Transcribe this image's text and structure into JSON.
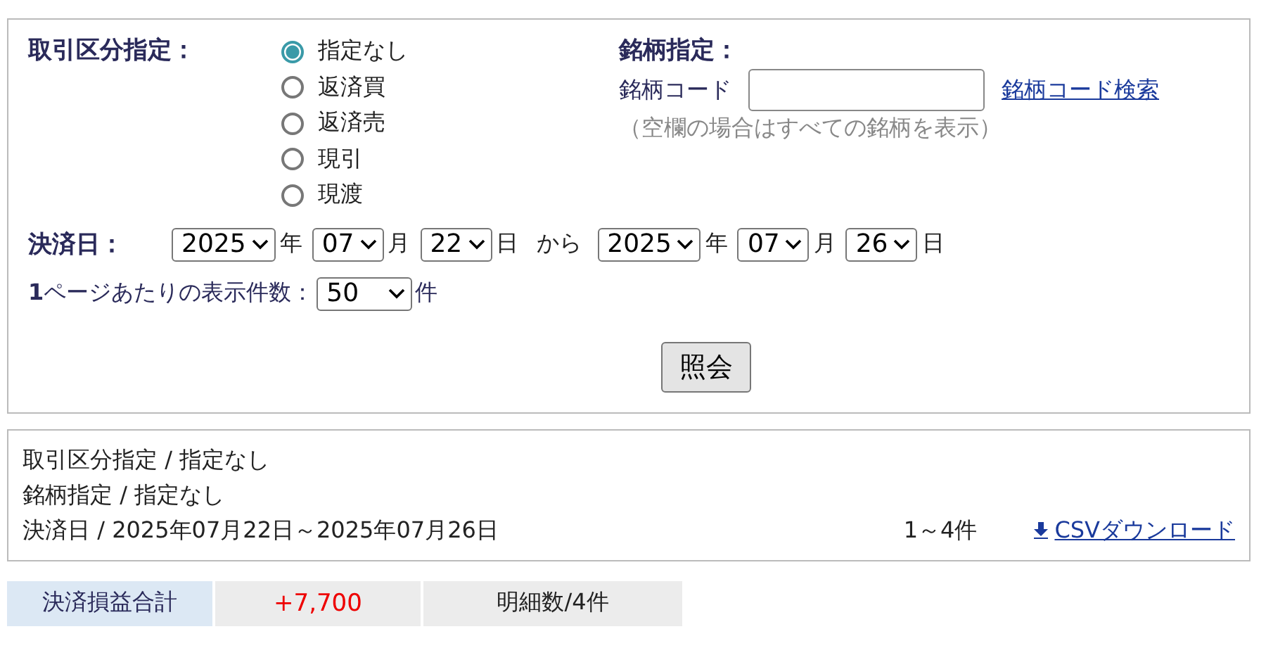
{
  "filter": {
    "trade_type": {
      "label": "取引区分指定：",
      "options": [
        {
          "label": "指定なし",
          "selected": true
        },
        {
          "label": "返済買",
          "selected": false
        },
        {
          "label": "返済売",
          "selected": false
        },
        {
          "label": "現引",
          "selected": false
        },
        {
          "label": "現渡",
          "selected": false
        }
      ]
    },
    "stock": {
      "label": "銘柄指定：",
      "code_label": "銘柄コード",
      "link": "銘柄コード検索",
      "hint": "（空欄の場合はすべての銘柄を表示）"
    },
    "date": {
      "label": "決済日：",
      "from": [
        {
          "value": "2025",
          "unit": "年"
        },
        {
          "value": "07",
          "unit": "月"
        },
        {
          "value": "22",
          "unit": "日"
        }
      ],
      "separator": "から",
      "to": [
        {
          "value": "2025",
          "unit": "年"
        },
        {
          "value": "07",
          "unit": "月"
        },
        {
          "value": "26",
          "unit": "日"
        }
      ]
    },
    "per_page": {
      "label": "**1**ページあたりの表示件数：",
      "value": "50",
      "unit": "件"
    },
    "submit": "照会"
  },
  "summary": {
    "lines": [
      "取引区分指定 / 指定なし",
      "銘柄指定 /  指定なし",
      "決済日 / 2025年07月22日～2025年07月26日"
    ],
    "count": "1～4件",
    "csv_link": "CSVダウンロード"
  },
  "totals": [
    {
      "kind": "label",
      "text": "決済損益合計"
    },
    {
      "kind": "value",
      "text": "+7,700"
    },
    {
      "kind": "count",
      "text": "明細数/4件"
    }
  ]
}
